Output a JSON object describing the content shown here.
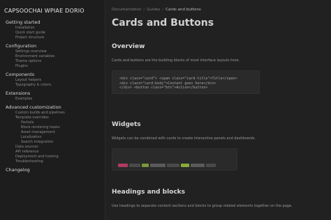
{
  "sidebar": {
    "brand": "CAPSOOCHAI WPIAE DORIO",
    "groups": [
      {
        "label": "Getting started",
        "items": [
          {
            "label": "Installation",
            "sub": false
          },
          {
            "label": "Quick start guide",
            "sub": false
          },
          {
            "label": "Project structure",
            "sub": false
          }
        ]
      },
      {
        "label": "Configuration",
        "items": [
          {
            "label": "Settings overview",
            "sub": false
          },
          {
            "label": "Environment variables",
            "sub": false
          },
          {
            "label": "Theme options",
            "sub": false
          },
          {
            "label": "Plugins",
            "sub": false
          }
        ]
      },
      {
        "label": "Components",
        "items": [
          {
            "label": "Layout helpers",
            "sub": false
          },
          {
            "label": "Typography & colors",
            "sub": false
          }
        ]
      },
      {
        "label": "Extensions",
        "items": [
          {
            "label": "Examples",
            "sub": false
          }
        ]
      },
      {
        "label": "Advanced customization",
        "items": [
          {
            "label": "Custom builds and pipelines",
            "sub": false
          },
          {
            "label": "Template overrides",
            "sub": false
          },
          {
            "label": "Partials",
            "sub": true
          },
          {
            "label": "Block rendering hooks",
            "sub": true
          },
          {
            "label": "Asset management",
            "sub": true
          },
          {
            "label": "Localization",
            "sub": true
          },
          {
            "label": "Search integration",
            "sub": true
          },
          {
            "label": "Data sources",
            "sub": false
          },
          {
            "label": "API reference",
            "sub": false
          },
          {
            "label": "Deployment and hosting",
            "sub": false
          },
          {
            "label": "Troubleshooting",
            "sub": false
          }
        ]
      },
      {
        "label": "Changelog",
        "items": []
      }
    ]
  },
  "breadcrumb": {
    "items": [
      "Documentation",
      "Guides"
    ],
    "current": "Cards and buttons"
  },
  "main": {
    "title": "Cards and Buttons",
    "sections": [
      {
        "title": "Overview",
        "paragraph": "Cards and buttons are the building blocks of most interface layouts here.",
        "code": [
          "<div class=\"card\"> <span class=\"card-title\">Title</span>",
          "<div class=\"card-body\">Content goes here</div>",
          "</div>  <button class=\"btn\">Action</button>"
        ]
      },
      {
        "title": "Widgets",
        "paragraph": "Widgets can be combined with cards to create interactive panels and dashboards.",
        "chips": [
          "#b03a62",
          "#4a4a4a",
          "#7a9a3a",
          "#5a5a5a",
          "#4a4a4a",
          "#8aaa3a",
          "#5a5a5a",
          "#4a4a4a"
        ]
      },
      {
        "title": "Headings and blocks",
        "paragraph": "Use headings to separate content sections and blocks to group related elements together on the page."
      }
    ]
  }
}
